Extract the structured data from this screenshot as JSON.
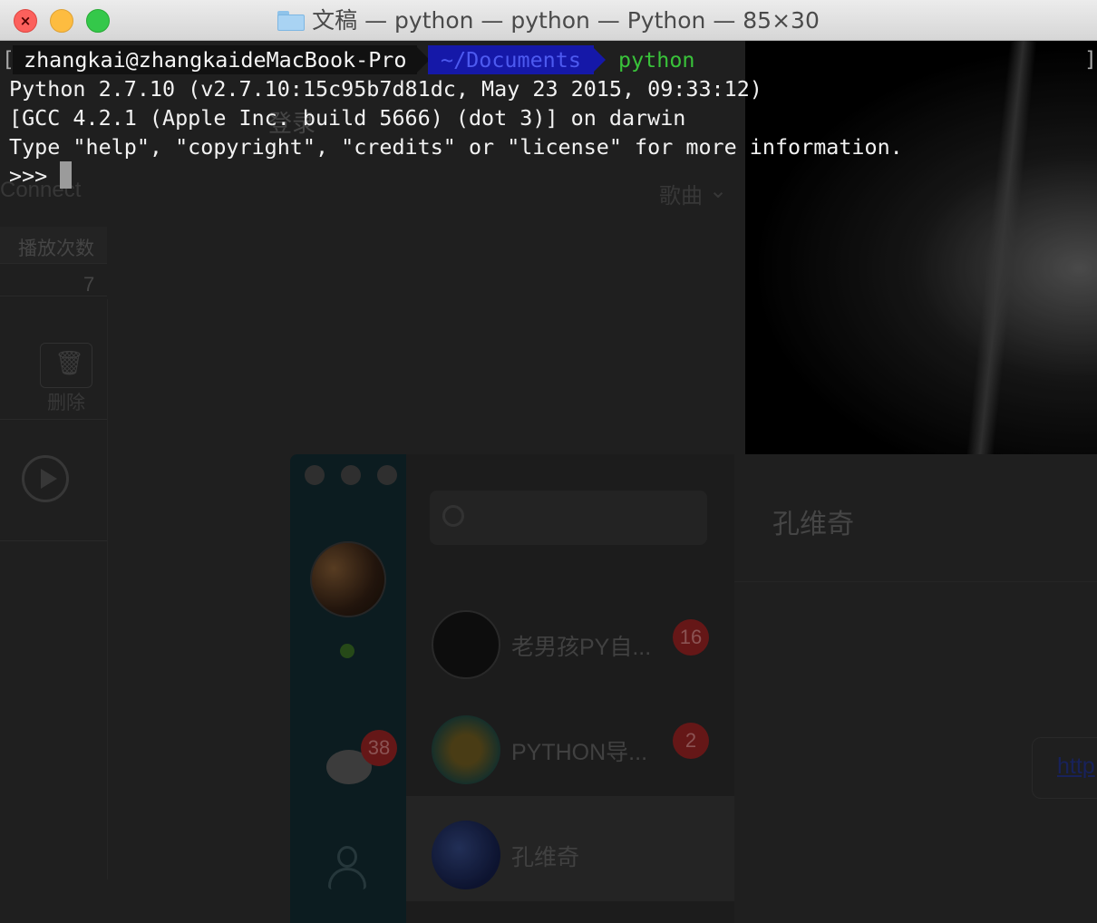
{
  "window": {
    "title": "文稿 — python — python — Python — 85×30"
  },
  "background": {
    "connect_label": "Connect",
    "songs_dropdown": "歌曲",
    "play_count_header": "播放次数",
    "play_count_value": "7",
    "delete_label": "删除",
    "login_label": "登录",
    "chat": {
      "contact_title": "孔维奇",
      "rail_badge": "38",
      "items": [
        {
          "name": "老男孩PY自...",
          "badge": "16"
        },
        {
          "name": "PYTHON导...",
          "badge": "2"
        },
        {
          "name": "孔维奇",
          "badge": ""
        }
      ],
      "link_text": "http"
    }
  },
  "terminal": {
    "prompt": {
      "bracket_left": "[",
      "bracket_right": "]",
      "user_host": "zhangkai@zhangkaideMacBook-Pro",
      "cwd": "~/Documents",
      "command": "python"
    },
    "lines": [
      "Python 2.7.10 (v2.7.10:15c95b7d81dc, May 23 2015, 09:33:12)",
      "[GCC 4.2.1 (Apple Inc. build 5666) (dot 3)] on darwin",
      "Type \"help\", \"copyright\", \"credits\" or \"license\" for more information."
    ],
    "repl_prompt": ">>>"
  },
  "colors": {
    "prompt_user_bg": "#111111",
    "prompt_dir_bg": "#1518a8",
    "prompt_cmd": "#39c23a"
  }
}
